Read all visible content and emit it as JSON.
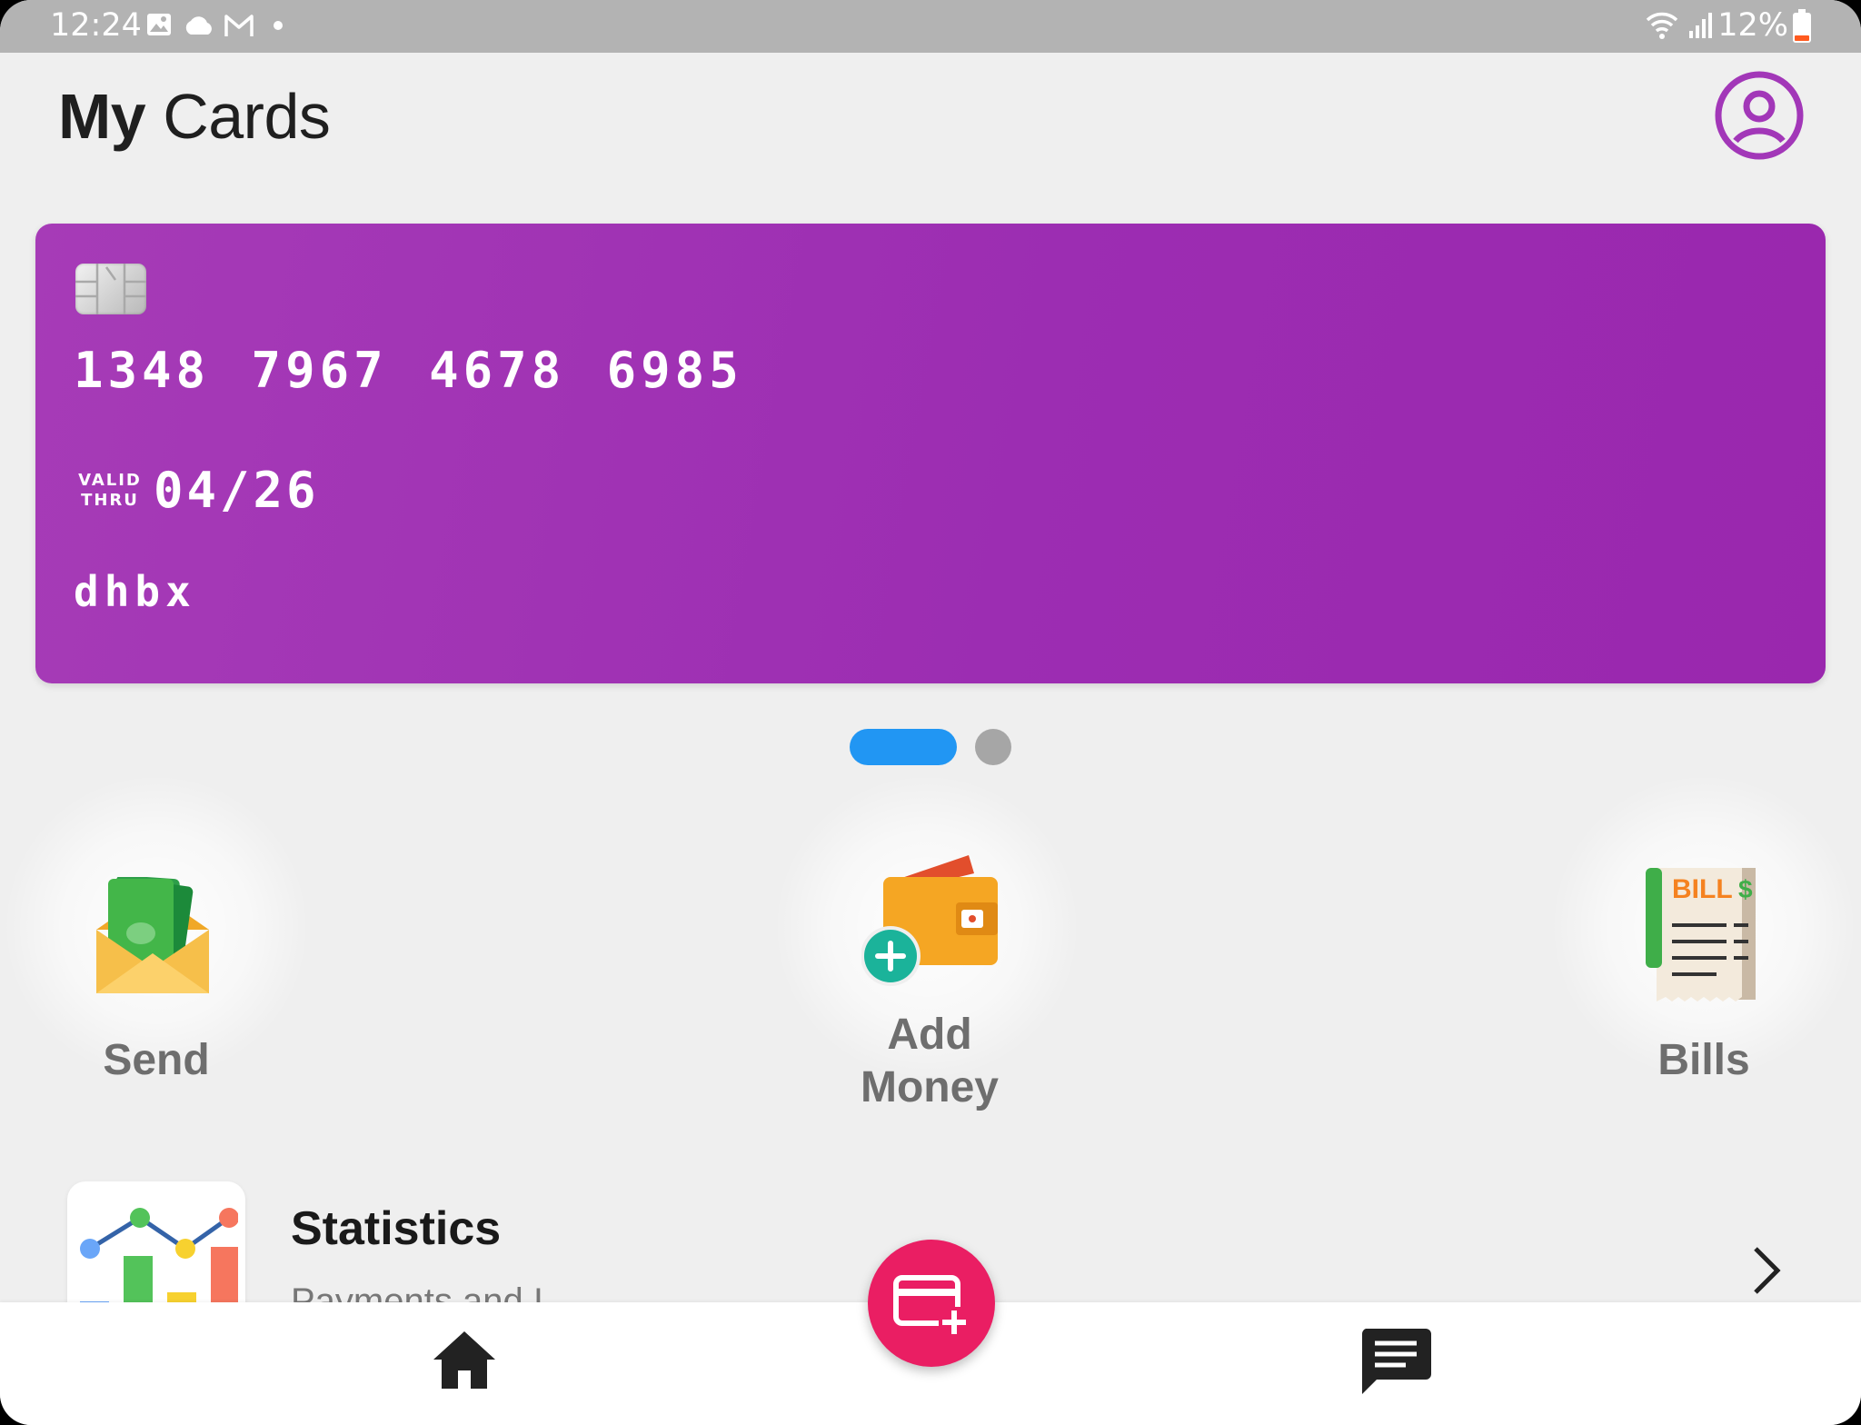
{
  "status_bar": {
    "time": "12:24",
    "battery_percent": "12%",
    "icons": [
      "gallery-icon",
      "cloud-icon",
      "gmail-icon",
      "notification-dot-icon",
      "wifi-icon",
      "signal-icon",
      "battery-icon"
    ]
  },
  "header": {
    "title_bold": "My",
    "title_rest": "Cards",
    "profile_icon": "account-circle-icon"
  },
  "card": {
    "number": "1348 7967 4678 6985",
    "valid_thru_label_line1": "VALID",
    "valid_thru_label_line2": "THRU",
    "expiry": "04/26",
    "holder_name": "dhbx",
    "color": "#9c2db2"
  },
  "pager": {
    "page_count": 2,
    "active_index": 0,
    "active_color": "#2196f3",
    "inactive_color": "#a6a6a6"
  },
  "actions": {
    "send_label": "Send",
    "add_money_line1": "Add",
    "add_money_line2": "Money",
    "bills_label": "Bills",
    "bill_icon_text": "BILL",
    "bill_icon_currency": "$"
  },
  "statistics": {
    "title": "Statistics",
    "subtitle": "Payments and I..."
  },
  "bottom_nav": {
    "items": [
      "home-icon",
      "add-card-icon",
      "chat-icon"
    ],
    "fab_color": "#ea1e63"
  }
}
